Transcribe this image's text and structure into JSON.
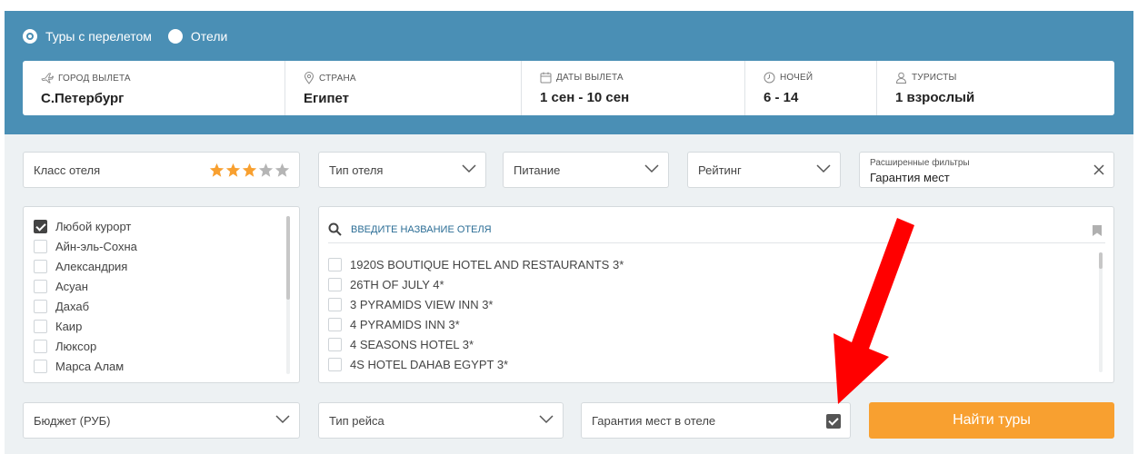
{
  "tour_type": {
    "options": [
      {
        "label": "Туры с перелетом",
        "selected": true
      },
      {
        "label": "Отели",
        "selected": false
      }
    ]
  },
  "search": {
    "departure": {
      "label": "ГОРОД ВЫЛЕТА",
      "value": "С.Петербург",
      "icon": "plane-icon"
    },
    "country": {
      "label": "СТРАНА",
      "value": "Египет",
      "icon": "map-pin-icon"
    },
    "dates": {
      "label": "ДАТЫ ВЫЛЕТА",
      "value": "1 сен - 10 сен",
      "icon": "calendar-icon"
    },
    "nights": {
      "label": "НОЧЕЙ",
      "value": "6 - 14",
      "icon": "clock-icon"
    },
    "tourists": {
      "label": "ТУРИСТЫ",
      "value": "1 взрослый",
      "icon": "user-icon"
    }
  },
  "filters": {
    "hotel_class": {
      "label": "Класс отеля",
      "stars_selected": 3,
      "stars_total": 5
    },
    "hotel_type": {
      "label": "Тип отеля"
    },
    "meals": {
      "label": "Питание"
    },
    "rating": {
      "label": "Рейтинг"
    },
    "advanced": {
      "label": "Расширенные фильтры",
      "value": "Гарантия мест"
    }
  },
  "resorts": [
    {
      "label": "Любой курорт",
      "checked": true
    },
    {
      "label": "Айн-эль-Сохна",
      "checked": false
    },
    {
      "label": "Александрия",
      "checked": false
    },
    {
      "label": "Асуан",
      "checked": false
    },
    {
      "label": "Дахаб",
      "checked": false
    },
    {
      "label": "Каир",
      "checked": false
    },
    {
      "label": "Люксор",
      "checked": false
    },
    {
      "label": "Марса Алам",
      "checked": false
    }
  ],
  "hotel_search": {
    "placeholder": "ВВЕДИТЕ НАЗВАНИЕ ОТЕЛЯ"
  },
  "hotels": [
    {
      "label": "1920S BOUTIQUE HOTEL AND RESTAURANTS 3*",
      "checked": false
    },
    {
      "label": "26TH OF JULY 4*",
      "checked": false
    },
    {
      "label": "3 PYRAMIDS VIEW INN 3*",
      "checked": false
    },
    {
      "label": "4 PYRAMIDS INN 3*",
      "checked": false
    },
    {
      "label": "4 SEASONS HOTEL 3*",
      "checked": false
    },
    {
      "label": "4S HOTEL DAHAB EGYPT 3*",
      "checked": false
    }
  ],
  "bottom": {
    "budget": {
      "label": "Бюджет (РУБ)"
    },
    "flight_type": {
      "label": "Тип рейса"
    },
    "guarantee": {
      "label": "Гарантия мест в отеле",
      "checked": true
    },
    "find_button": "Найти туры"
  },
  "colors": {
    "header_bg": "#4a8fb5",
    "filters_bg": "#edf1f3",
    "star_active": "#f8a030",
    "star_inactive": "#b5b5b5",
    "find_button": "#f8a030",
    "arrow": "#ff0000"
  }
}
